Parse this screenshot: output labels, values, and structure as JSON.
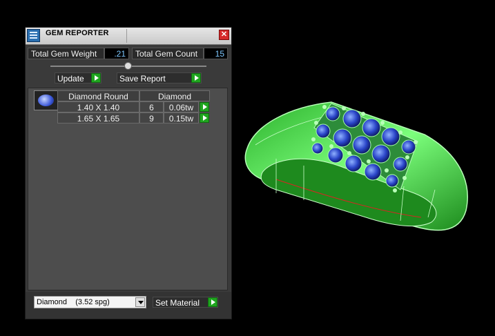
{
  "window": {
    "title": "GEM REPORTER",
    "close_symbol": "✕"
  },
  "stats": {
    "weight_label": "Total Gem Weight",
    "weight_value": ".21",
    "count_label": "Total Gem Count",
    "count_value": "15"
  },
  "actions": {
    "update_label": "Update",
    "save_report_label": "Save Report"
  },
  "table": {
    "thumbnail_icon": "round-diamond-icon",
    "headers": [
      "Diamond Round",
      "Diamond"
    ],
    "rows": [
      {
        "size": "1.40 X 1.40",
        "count": "6",
        "weight": "0.06tw"
      },
      {
        "size": "1.65 X 1.65",
        "count": "9",
        "weight": "0.15tw"
      }
    ]
  },
  "material": {
    "selected": "Diamond    (3.52 spg)",
    "set_label": "Set Material"
  },
  "colors": {
    "accent_green": "#1fa51f",
    "stone_blue": "#3b57d8",
    "ring_green": "#5cf05c"
  }
}
